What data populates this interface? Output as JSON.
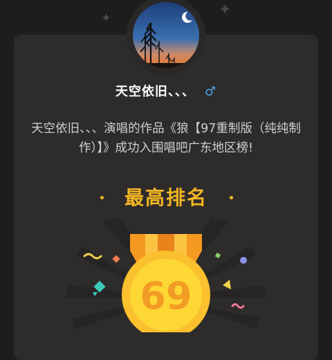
{
  "profile": {
    "username": "天空依旧、、、",
    "gender_symbol": "♂"
  },
  "announcement": {
    "text": "天空依旧、、、演唱的作品《狼【97重制版（纯纯制作）】》成功入围唱吧广东地区榜!"
  },
  "rank": {
    "title": "最高排名",
    "value": "69"
  },
  "colors": {
    "background": "#1e1c1c",
    "card": "#2e2b2b",
    "accent_gold": "#f3b624",
    "gender_blue": "#4aa3e0"
  },
  "icons": [
    "sparkle-icon",
    "male-icon",
    "medal-icon"
  ]
}
